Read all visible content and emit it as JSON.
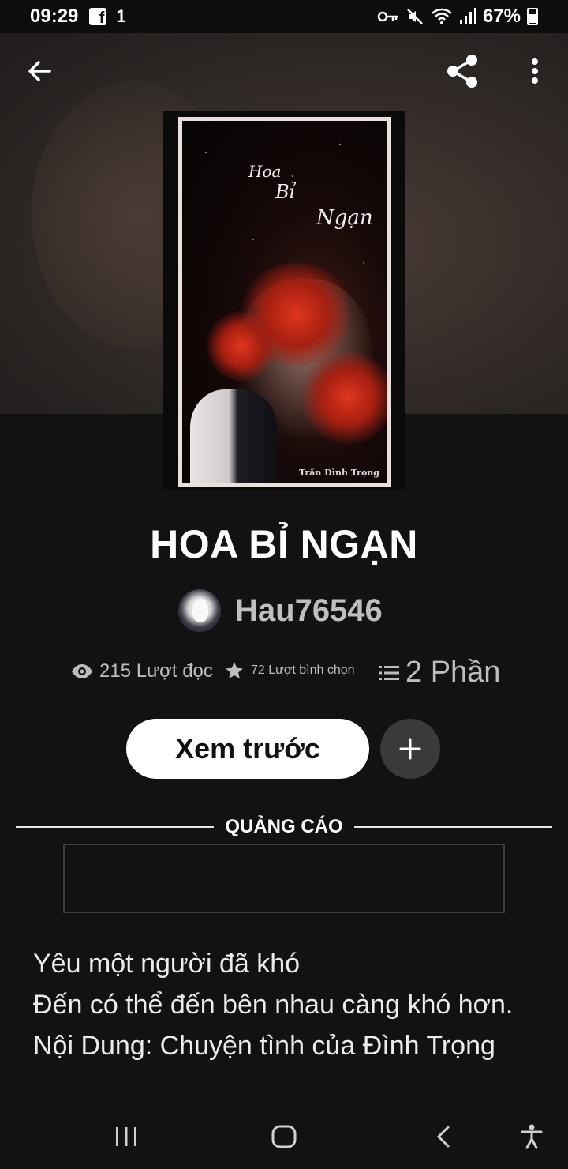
{
  "status_bar": {
    "time": "09:29",
    "notification_count": "1",
    "battery_percent": "67%"
  },
  "story": {
    "title": "HOA BỈ NGẠN",
    "author": "Hau76546",
    "reads": "215 Lượt đọc",
    "votes": "72 Lượt bình chọn",
    "parts": "2 Phần",
    "cover": {
      "script_title": [
        "Hoa",
        "Bỉ",
        "Ngạn"
      ],
      "credit": "Trần Đình Trọng"
    }
  },
  "actions": {
    "preview_label": "Xem trước",
    "add_label": "+"
  },
  "ad": {
    "label": "QUẢNG CÁO"
  },
  "description": {
    "lines": [
      "Yêu một người đã khó",
      "Đến có thể đến bên nhau càng khó hơn.",
      "Nội Dung: Chuyện tình của Đình Trọng"
    ]
  },
  "icons": {
    "back": "arrow-left-icon",
    "share": "share-icon",
    "more": "more-vert-icon",
    "reads": "eye-icon",
    "votes": "star-icon",
    "parts": "list-icon",
    "nav_recent": "recent-apps-icon",
    "nav_home": "home-icon",
    "nav_back": "back-chevron-icon",
    "nav_accessibility": "accessibility-icon"
  },
  "colors": {
    "background": "#121212",
    "button_bg": "#ffffff",
    "muted_text": "#bdbdbd",
    "add_button_bg": "#3a3a3a"
  }
}
